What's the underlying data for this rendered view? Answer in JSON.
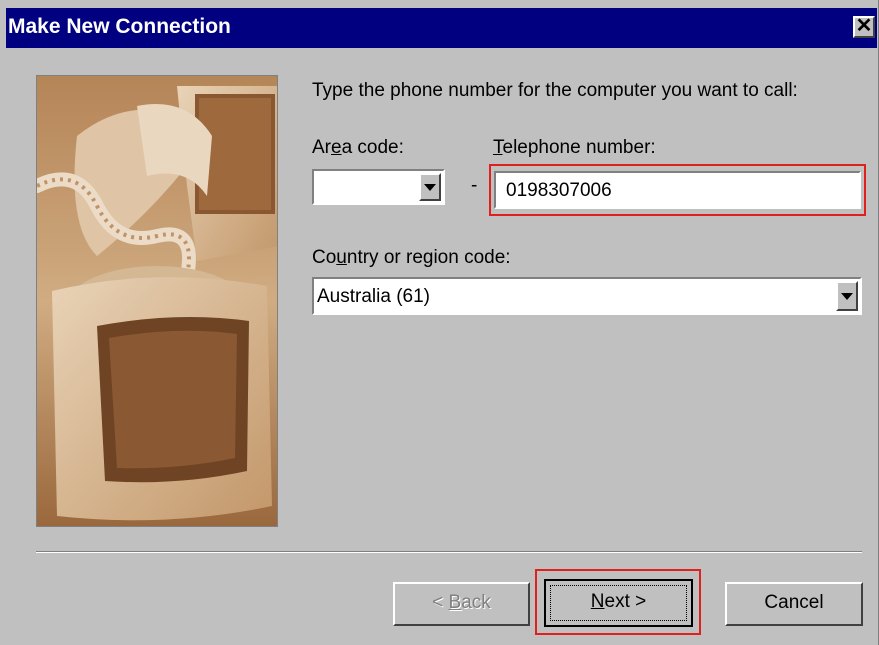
{
  "window": {
    "title": "Make New Connection",
    "close_symbol": "✕",
    "close_icon": "close-icon"
  },
  "content": {
    "instruction": "Type the phone number for the computer you want to call:",
    "area_code": {
      "label_prefix": "Ar",
      "label_accel": "e",
      "label_suffix": "a code:",
      "value": "",
      "dropdown_icon": "chevron-down-icon"
    },
    "dash": "-",
    "telephone": {
      "label_accel": "T",
      "label_suffix": "elephone number:",
      "value": "0198307006"
    },
    "country": {
      "label_prefix": "Co",
      "label_accel": "u",
      "label_suffix": "ntry or region code:",
      "value": "Australia (61)",
      "dropdown_icon": "chevron-down-icon"
    }
  },
  "buttons": {
    "back": {
      "prefix": "< ",
      "accel": "B",
      "suffix": "ack"
    },
    "next": {
      "accel": "N",
      "suffix": "ext >"
    },
    "cancel": {
      "label": "Cancel"
    }
  },
  "colors": {
    "titlebar": "#000080",
    "face": "#c0c0c0",
    "highlight_box": "#e0201c"
  }
}
